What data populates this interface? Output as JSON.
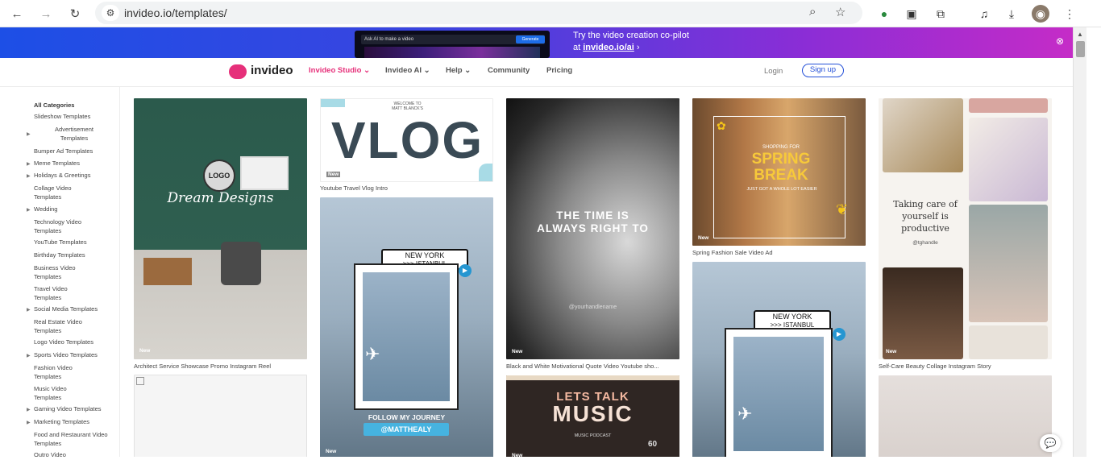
{
  "browser": {
    "url": "invideo.io/templates/",
    "back_icon": "←",
    "forward_icon": "→",
    "reload_icon": "↻",
    "zoom_icon": "⌕",
    "star_icon": "☆",
    "menu_icon": "⋮"
  },
  "banner": {
    "line1": "Try the video creation co-pilot",
    "line2_prefix": "at ",
    "line2_link": "invideo.io/ai",
    "line2_suffix": " ›",
    "ask_placeholder": "Ask AI to make a video",
    "generate": "Generate"
  },
  "header": {
    "brand": "invideo",
    "nav": [
      {
        "label": "Invideo Studio ⌄"
      },
      {
        "label": "Invideo AI ⌄"
      },
      {
        "label": "Help ⌄"
      },
      {
        "label": "Community"
      },
      {
        "label": "Pricing"
      }
    ],
    "login": "Login",
    "signup": "Sign up"
  },
  "sidebar": {
    "title": "All Categories",
    "items": [
      {
        "label": "Slideshow Templates"
      },
      {
        "label": "Advertisement Templates"
      },
      {
        "label": "Bumper Ad Templates"
      },
      {
        "label": "Meme Templates"
      },
      {
        "label": "Holidays & Greetings"
      },
      {
        "label": "Collage Video Templates"
      },
      {
        "label": "Wedding"
      },
      {
        "label": "Technology Video Templates"
      },
      {
        "label": "YouTube Templates"
      },
      {
        "label": "Birthday Templates"
      },
      {
        "label": "Business Video Templates"
      },
      {
        "label": "Travel Video Templates"
      },
      {
        "label": "Social Media Templates"
      },
      {
        "label": "Real Estate Video Templates"
      },
      {
        "label": "Logo Video Templates"
      },
      {
        "label": "Sports Video Templates"
      },
      {
        "label": "Fashion Video Templates"
      },
      {
        "label": "Music Video Templates"
      },
      {
        "label": "Gaming Video Templates"
      },
      {
        "label": "Marketing Templates"
      },
      {
        "label": "Food and Restaurant Video Templates"
      },
      {
        "label": "Outro Video"
      }
    ]
  },
  "templates": {
    "new_label": "New",
    "architect": {
      "caption": "Architect Service Showcase Promo Instagram Reel",
      "logo": "LOGO",
      "script": "Dream Designs"
    },
    "vlog": {
      "caption": "Youtube Travel Vlog Intro",
      "big": "VLOG",
      "top": "WELCOME TO\nMATT BLANCK'S"
    },
    "journey1": {
      "city1": "NEW YORK",
      "city2": ">>> ISTANBUL",
      "follow": "FOLLOW MY JOURNEY",
      "handle": "@MATTHEALY"
    },
    "clock": {
      "caption": "Black and White Motivational Quote Video Youtube sho...",
      "quote": "THE TIME IS ALWAYS RIGHT TO",
      "handle": "@yourhandlename"
    },
    "music": {
      "title1": "LETS TALK",
      "title2": "MUSIC",
      "sub": "MUSIC PODCAST",
      "badge": "60"
    },
    "spring": {
      "caption": "Spring Fashion Sale Video Ad",
      "shopping": "SHOPPING FOR",
      "spring": "SPRING",
      "break": "BREAK",
      "sub": "JUST GOT A WHOLE LOT EASIER"
    },
    "journey2": {
      "city1": "NEW YORK",
      "city2": ">>> ISTANBUL"
    },
    "selfcare": {
      "caption": "Self-Care Beauty Collage Instagram Story",
      "text": "Taking care of yourself is productive",
      "handle": "@tghandle"
    }
  },
  "chat_icon": "💬"
}
